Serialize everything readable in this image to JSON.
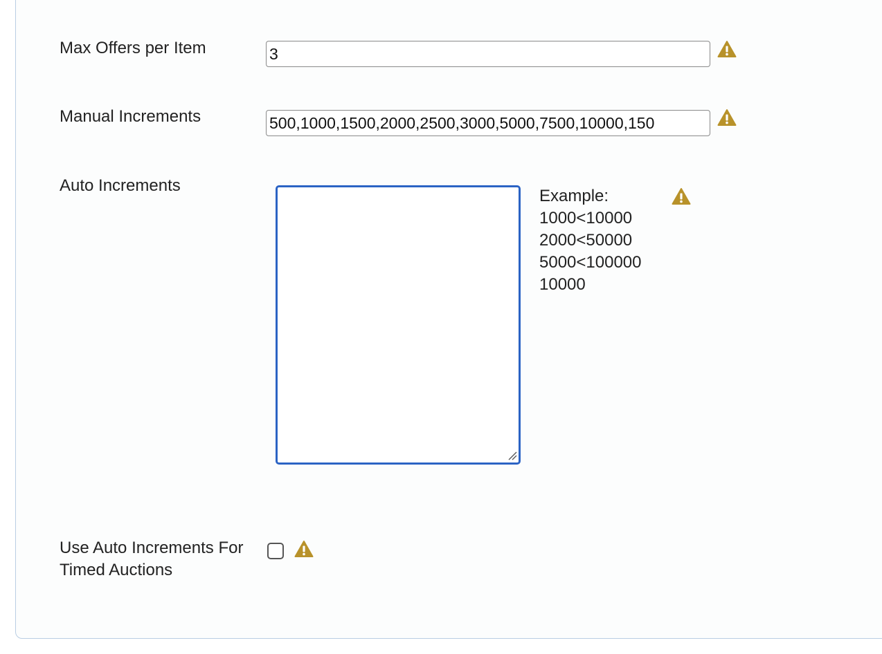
{
  "form": {
    "max_offers": {
      "label": "Max Offers per Item",
      "value": "3",
      "warning_icon": "warning-triangle-icon"
    },
    "manual_increments": {
      "label": "Manual Increments",
      "value": "500,1000,1500,2000,2500,3000,5000,7500,10000,150",
      "warning_icon": "warning-triangle-icon"
    },
    "auto_increments": {
      "label": "Auto Increments",
      "value": "",
      "example_title": "Example:",
      "example_lines": [
        "1000<10000",
        "2000<50000",
        "5000<100000",
        "10000"
      ],
      "warning_icon": "warning-triangle-icon"
    },
    "use_auto_timed": {
      "label_line1": "Use Auto Increments For",
      "label_line2": "Timed Auctions",
      "checked": false,
      "warning_icon": "warning-triangle-icon"
    }
  },
  "colors": {
    "warning": "#b8922a",
    "focus_border": "#2b63c4",
    "panel_border": "#b9cde3"
  }
}
